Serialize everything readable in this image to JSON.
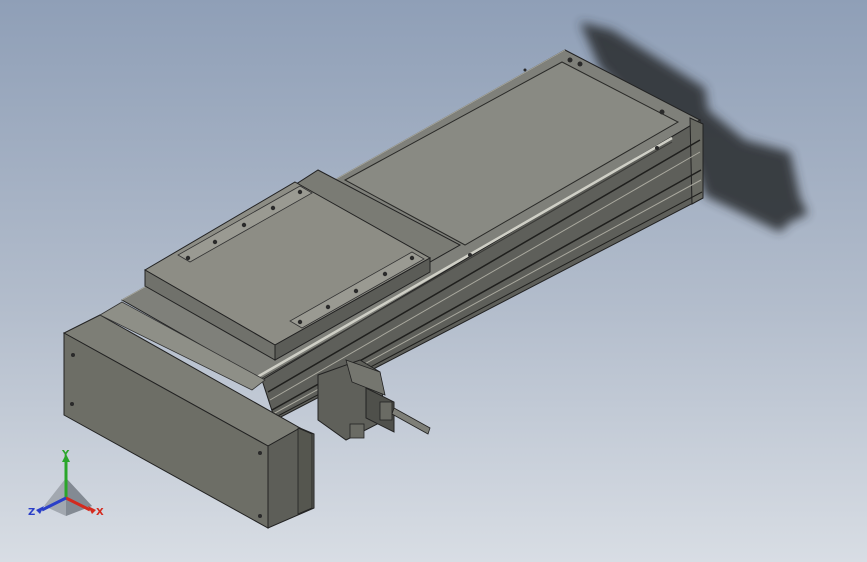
{
  "viewport": {
    "background_top": "#8f9fb7",
    "background_bottom": "#d8dde4",
    "model_body_color": "#8a8a80",
    "carriage_color": "#8d8d85",
    "shadow_color": "#2e3136"
  },
  "triad": {
    "x_label": "X",
    "y_label": "Y",
    "z_label": "Z",
    "x_color": "#d42a1e",
    "y_color": "#2aa62a",
    "z_color": "#2a3fc8"
  }
}
